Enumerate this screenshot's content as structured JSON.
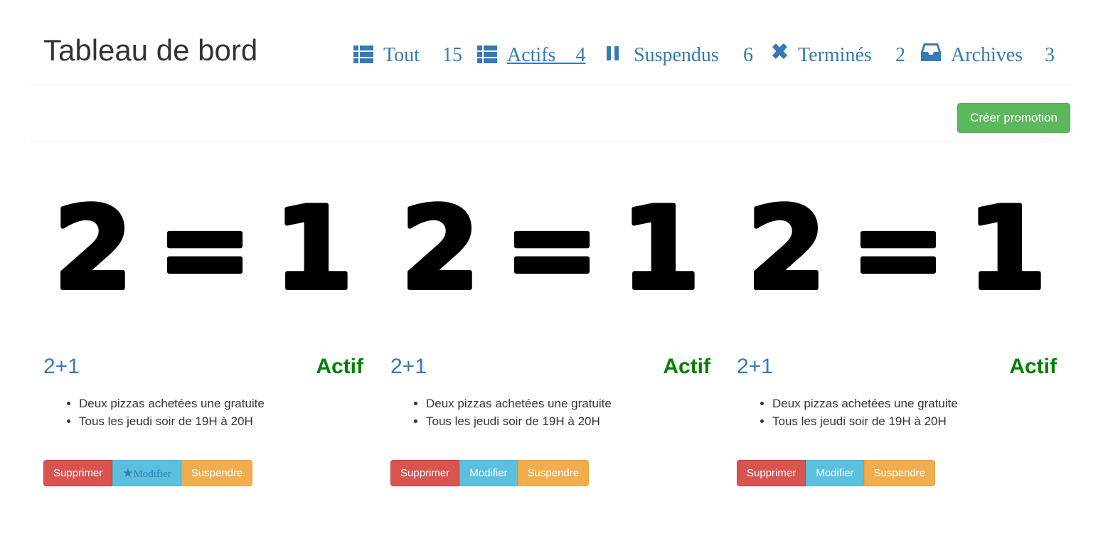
{
  "header": {
    "title": "Tableau de bord",
    "filters": [
      {
        "label": "Tout",
        "count": "15",
        "icon": "list-icon"
      },
      {
        "label": "Actifs",
        "count": "4",
        "icon": "list-icon",
        "active": true
      },
      {
        "label": "Suspendus",
        "count": "6",
        "icon": "pause-icon"
      },
      {
        "label": "Terminés",
        "count": "2",
        "icon": "close-icon"
      },
      {
        "label": "Archives",
        "count": "3",
        "icon": "inbox-icon"
      }
    ]
  },
  "toolbar": {
    "create_label": "Créer promotion"
  },
  "cards": [
    {
      "image_text": {
        "left": "2",
        "middle": "=",
        "right": "1"
      },
      "code": "2+1",
      "status": "Actif",
      "details": [
        "Deux pizzas achetées une gratuite",
        "Tous les jeudi soir de 19H à 20H"
      ],
      "buttons": {
        "delete": "Supprimer",
        "edit": "Modifier",
        "suspend": "Suspendre"
      }
    },
    {
      "image_text": {
        "left": "2",
        "middle": "=",
        "right": "1"
      },
      "code": "2+1",
      "status": "Actif",
      "details": [
        "Deux pizzas achetées une gratuite",
        "Tous les jeudi soir de 19H à 20H"
      ],
      "buttons": {
        "delete": "Supprimer",
        "edit": "Modifier",
        "suspend": "Suspendre"
      }
    },
    {
      "image_text": {
        "left": "2",
        "middle": "=",
        "right": "1"
      },
      "code": "2+1",
      "status": "Actif",
      "details": [
        "Deux pizzas achetées une gratuite",
        "Tous les jeudi soir de 19H à 20H"
      ],
      "buttons": {
        "delete": "Supprimer",
        "edit": "Modifier",
        "suspend": "Suspendre"
      }
    }
  ],
  "colors": {
    "link": "#337ab7",
    "success": "#5cb85c",
    "danger": "#d9534f",
    "info": "#5bc0de",
    "warning": "#f0ad4e",
    "status_active": "#008000"
  }
}
